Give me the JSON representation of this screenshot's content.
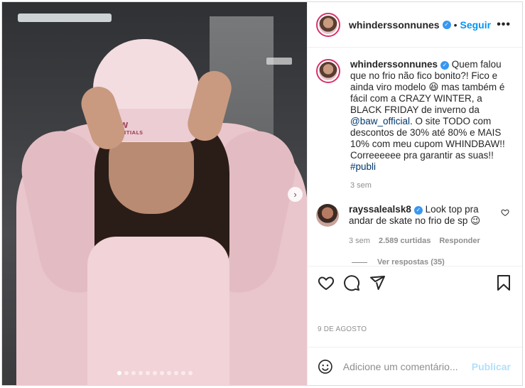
{
  "post": {
    "author": "whinderssonnunes",
    "follow_sep": "•",
    "follow_label": "Seguir",
    "more_label": "•••",
    "caption": {
      "author": "whinderssonnunes",
      "pre": "Quem falou que no frio não fico bonito?! Fico e ainda viro modelo 😆 mas também é fácil com a CRAZY WINTER, a BLACK FRIDAY de inverno da ",
      "mention": "@baw_official",
      "mid": ". O site TODO com descontos de 30% até 80% e MAIS 10% com meu cupom WHINDBAW!! Correeeeee pra garantir as suas!! ",
      "hashtag": "#publi",
      "time": "3 sem"
    },
    "comment": {
      "author": "rayssalealsk8",
      "text": "Look top pra andar de skate no frio de sp 😉",
      "time": "3 sem",
      "likes": "2.589 curtidas",
      "reply_label": "Responder"
    },
    "view_replies": "Ver respostas (35)",
    "date": "9 DE AGOSTO",
    "add_comment_placeholder": "Adicione um comentário...",
    "publish_label": "Publicar",
    "beanie_brand": "BAW",
    "beanie_sub": "ESSENTIALS",
    "carousel_dots": 11,
    "carousel_active": 0
  },
  "colors": {
    "accent": "#0095f6",
    "verified": "#3897f0",
    "publish_disabled": "#b2dffc",
    "muted": "#8e8e8e"
  },
  "icons": [
    "verified-icon",
    "more-icon",
    "heart-icon",
    "comment-icon",
    "share-icon",
    "save-icon",
    "emoji-icon",
    "chevron-right-icon"
  ]
}
